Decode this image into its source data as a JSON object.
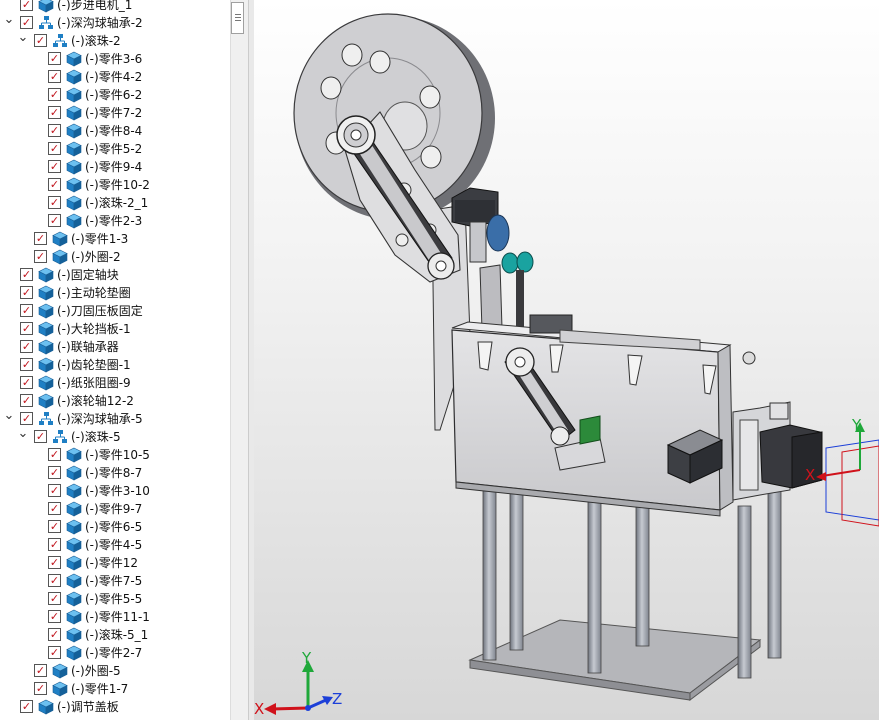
{
  "tree": {
    "items": [
      {
        "label": "(-)步进电机_1",
        "indent": 0,
        "toggle": "",
        "icon": "part"
      },
      {
        "label": "(-)深沟球轴承-2",
        "indent": 0,
        "toggle": "expanded",
        "icon": "assembly"
      },
      {
        "label": "(-)滚珠-2",
        "indent": 1,
        "toggle": "expanded",
        "icon": "assembly"
      },
      {
        "label": "(-)零件3-6",
        "indent": 2,
        "toggle": "",
        "icon": "part"
      },
      {
        "label": "(-)零件4-2",
        "indent": 2,
        "toggle": "",
        "icon": "part"
      },
      {
        "label": "(-)零件6-2",
        "indent": 2,
        "toggle": "",
        "icon": "part"
      },
      {
        "label": "(-)零件7-2",
        "indent": 2,
        "toggle": "",
        "icon": "part"
      },
      {
        "label": "(-)零件8-4",
        "indent": 2,
        "toggle": "",
        "icon": "part"
      },
      {
        "label": "(-)零件5-2",
        "indent": 2,
        "toggle": "",
        "icon": "part"
      },
      {
        "label": "(-)零件9-4",
        "indent": 2,
        "toggle": "",
        "icon": "part"
      },
      {
        "label": "(-)零件10-2",
        "indent": 2,
        "toggle": "",
        "icon": "part"
      },
      {
        "label": "(-)滚珠-2_1",
        "indent": 2,
        "toggle": "",
        "icon": "part"
      },
      {
        "label": "(-)零件2-3",
        "indent": 2,
        "toggle": "",
        "icon": "part"
      },
      {
        "label": "(-)零件1-3",
        "indent": 1,
        "toggle": "",
        "icon": "part"
      },
      {
        "label": "(-)外圈-2",
        "indent": 1,
        "toggle": "",
        "icon": "part"
      },
      {
        "label": "(-)固定轴块",
        "indent": 0,
        "toggle": "",
        "icon": "part"
      },
      {
        "label": "(-)主动轮垫圈",
        "indent": 0,
        "toggle": "",
        "icon": "part"
      },
      {
        "label": "(-)刀固压板固定",
        "indent": 0,
        "toggle": "",
        "icon": "part"
      },
      {
        "label": "(-)大轮挡板-1",
        "indent": 0,
        "toggle": "",
        "icon": "part"
      },
      {
        "label": "(-)联轴承器",
        "indent": 0,
        "toggle": "",
        "icon": "part"
      },
      {
        "label": "(-)齿轮垫圈-1",
        "indent": 0,
        "toggle": "",
        "icon": "part"
      },
      {
        "label": "(-)纸张阻圈-9",
        "indent": 0,
        "toggle": "",
        "icon": "part"
      },
      {
        "label": "(-)滚轮轴12-2",
        "indent": 0,
        "toggle": "",
        "icon": "part"
      },
      {
        "label": "(-)深沟球轴承-5",
        "indent": 0,
        "toggle": "expanded",
        "icon": "assembly"
      },
      {
        "label": "(-)滚珠-5",
        "indent": 1,
        "toggle": "expanded",
        "icon": "assembly"
      },
      {
        "label": "(-)零件10-5",
        "indent": 2,
        "toggle": "",
        "icon": "part"
      },
      {
        "label": "(-)零件8-7",
        "indent": 2,
        "toggle": "",
        "icon": "part"
      },
      {
        "label": "(-)零件3-10",
        "indent": 2,
        "toggle": "",
        "icon": "part"
      },
      {
        "label": "(-)零件9-7",
        "indent": 2,
        "toggle": "",
        "icon": "part"
      },
      {
        "label": "(-)零件6-5",
        "indent": 2,
        "toggle": "",
        "icon": "part"
      },
      {
        "label": "(-)零件4-5",
        "indent": 2,
        "toggle": "",
        "icon": "part"
      },
      {
        "label": "(-)零件12",
        "indent": 2,
        "toggle": "",
        "icon": "part"
      },
      {
        "label": "(-)零件7-5",
        "indent": 2,
        "toggle": "",
        "icon": "part"
      },
      {
        "label": "(-)零件5-5",
        "indent": 2,
        "toggle": "",
        "icon": "part"
      },
      {
        "label": "(-)零件11-1",
        "indent": 2,
        "toggle": "",
        "icon": "part"
      },
      {
        "label": "(-)滚珠-5_1",
        "indent": 2,
        "toggle": "",
        "icon": "part"
      },
      {
        "label": "(-)零件2-7",
        "indent": 2,
        "toggle": "",
        "icon": "part"
      },
      {
        "label": "(-)外圈-5",
        "indent": 1,
        "toggle": "",
        "icon": "part"
      },
      {
        "label": "(-)零件1-7",
        "indent": 1,
        "toggle": "",
        "icon": "part"
      },
      {
        "label": "(-)调节盖板",
        "indent": 0,
        "toggle": "",
        "icon": "part"
      }
    ]
  },
  "triad": {
    "x": "X",
    "y": "Y",
    "z": "Z"
  },
  "part_triad": {
    "x": "X",
    "y": "Y"
  },
  "colors": {
    "check": "#c0141c",
    "part_icon": "#1f7fc4",
    "assembly_icon": "#1f7fc4",
    "axis_x": "#d0121b",
    "axis_y": "#1fa83a",
    "axis_z": "#1c3fd8"
  }
}
